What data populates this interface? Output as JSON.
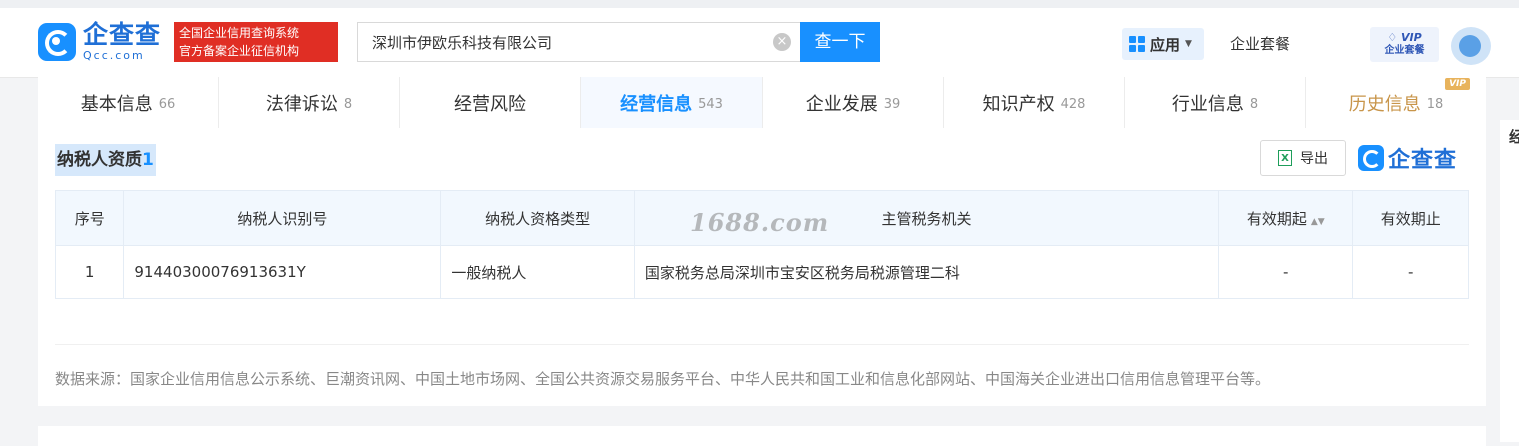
{
  "header": {
    "logo_cn": "企查查",
    "logo_en": "Qcc.com",
    "badge_line1": "全国企业信用查询系统",
    "badge_line2": "官方备案企业征信机构",
    "search_value": "深圳市伊欧乐科技有限公司",
    "clear_icon": "×",
    "search_button": "查一下",
    "apps_label": "应用",
    "package_label": "企业套餐",
    "vip_line1": "VIP",
    "vip_line2": "企业套餐"
  },
  "tabs": [
    {
      "label": "基本信息",
      "count": "66"
    },
    {
      "label": "法律诉讼",
      "count": "8"
    },
    {
      "label": "经营风险",
      "count": ""
    },
    {
      "label": "经营信息",
      "count": "543"
    },
    {
      "label": "企业发展",
      "count": "39"
    },
    {
      "label": "知识产权",
      "count": "428"
    },
    {
      "label": "行业信息",
      "count": "8"
    },
    {
      "label": "历史信息",
      "count": "18",
      "tag": "VIP"
    }
  ],
  "section": {
    "title": "纳税人资质",
    "count": "1",
    "export_label": "导出",
    "brand": "企查查"
  },
  "table": {
    "headers": [
      "序号",
      "纳税人识别号",
      "纳税人资格类型",
      "主管税务机关",
      "有效期起",
      "有效期止"
    ],
    "rows": [
      [
        "1",
        "91440300076913631Y",
        "一般纳税人",
        "国家税务总局深圳市宝安区税务局税源管理二科",
        "-",
        "-"
      ]
    ]
  },
  "watermark": "1688.com",
  "source_text": "数据来源：国家企业信用信息公示系统、巨潮资讯网、中国土地市场网、全国公共资源交易服务平台、中华人民共和国工业和信息化部网站、中国海关企业进出口信用信息管理平台等。",
  "right_panel_char": "经"
}
